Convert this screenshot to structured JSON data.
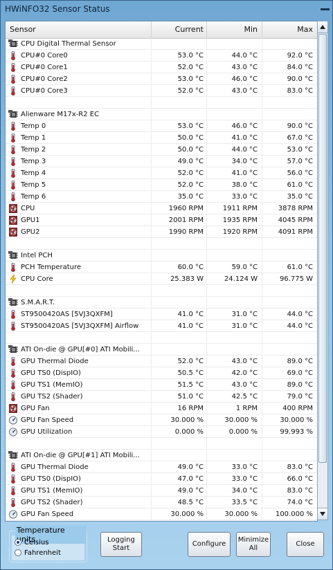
{
  "window": {
    "title": "HWiNFO32 Sensor Status"
  },
  "columns": {
    "sensor": "Sensor",
    "current": "Current",
    "min": "Min",
    "max": "Max"
  },
  "rows": [
    {
      "type": "group",
      "icon": "chip-icon",
      "name": "CPU Digital Thermal Sensor"
    },
    {
      "type": "data",
      "icon": "thermometer-icon",
      "name": "CPU#0 Core0",
      "current": "53.0 °C",
      "min": "44.0 °C",
      "max": "92.0 °C"
    },
    {
      "type": "data",
      "icon": "thermometer-icon",
      "name": "CPU#0 Core1",
      "current": "52.0 °C",
      "min": "43.0 °C",
      "max": "84.0 °C"
    },
    {
      "type": "data",
      "icon": "thermometer-icon",
      "name": "CPU#0 Core2",
      "current": "53.0 °C",
      "min": "46.0 °C",
      "max": "90.0 °C"
    },
    {
      "type": "data",
      "icon": "thermometer-icon",
      "name": "CPU#0 Core3",
      "current": "52.0 °C",
      "min": "43.0 °C",
      "max": "83.0 °C"
    },
    {
      "type": "blank"
    },
    {
      "type": "group",
      "icon": "chip-icon",
      "name": "Alienware M17x-R2 EC"
    },
    {
      "type": "data",
      "icon": "thermometer-icon",
      "name": "Temp 0",
      "current": "53.0 °C",
      "min": "46.0 °C",
      "max": "90.0 °C"
    },
    {
      "type": "data",
      "icon": "thermometer-icon",
      "name": "Temp 1",
      "current": "50.0 °C",
      "min": "41.0 °C",
      "max": "67.0 °C"
    },
    {
      "type": "data",
      "icon": "thermometer-icon",
      "name": "Temp 2",
      "current": "50.0 °C",
      "min": "44.0 °C",
      "max": "53.0 °C"
    },
    {
      "type": "data",
      "icon": "thermometer-icon",
      "name": "Temp 3",
      "current": "49.0 °C",
      "min": "34.0 °C",
      "max": "57.0 °C"
    },
    {
      "type": "data",
      "icon": "thermometer-icon",
      "name": "Temp 4",
      "current": "52.0 °C",
      "min": "41.0 °C",
      "max": "56.0 °C"
    },
    {
      "type": "data",
      "icon": "thermometer-icon",
      "name": "Temp 5",
      "current": "52.0 °C",
      "min": "38.0 °C",
      "max": "61.0 °C"
    },
    {
      "type": "data",
      "icon": "thermometer-icon",
      "name": "Temp 6",
      "current": "35.0 °C",
      "min": "33.0 °C",
      "max": "35.0 °C"
    },
    {
      "type": "data",
      "icon": "fan-icon",
      "name": "CPU",
      "current": "1960 RPM",
      "min": "1911 RPM",
      "max": "3878 RPM"
    },
    {
      "type": "data",
      "icon": "fan-icon",
      "name": "GPU1",
      "current": "2001 RPM",
      "min": "1935 RPM",
      "max": "4045 RPM"
    },
    {
      "type": "data",
      "icon": "fan-icon",
      "name": "GPU2",
      "current": "1990 RPM",
      "min": "1920 RPM",
      "max": "4091 RPM"
    },
    {
      "type": "blank"
    },
    {
      "type": "group",
      "icon": "chip-icon",
      "name": "Intel PCH"
    },
    {
      "type": "data",
      "icon": "thermometer-icon",
      "name": "PCH Temperature",
      "current": "60.0 °C",
      "min": "59.0 °C",
      "max": "61.0 °C"
    },
    {
      "type": "data",
      "icon": "lightning-icon",
      "name": "CPU Core",
      "current": "25.383 W",
      "min": "24.124 W",
      "max": "96.775 W"
    },
    {
      "type": "blank"
    },
    {
      "type": "group",
      "icon": "chip-icon",
      "name": "S.M.A.R.T."
    },
    {
      "type": "data",
      "icon": "thermometer-icon",
      "name": "ST9500420AS [5VJ3QXFM]",
      "current": "41.0 °C",
      "min": "31.0 °C",
      "max": "44.0 °C"
    },
    {
      "type": "data",
      "icon": "thermometer-icon",
      "name": "ST9500420AS [5VJ3QXFM] Airflow",
      "current": "41.0 °C",
      "min": "31.0 °C",
      "max": "44.0 °C"
    },
    {
      "type": "blank"
    },
    {
      "type": "group",
      "icon": "chip-icon",
      "name": "ATI On-die @ GPU[#0] ATI Mobili..."
    },
    {
      "type": "data",
      "icon": "thermometer-icon",
      "name": "GPU Thermal Diode",
      "current": "52.0 °C",
      "min": "43.0 °C",
      "max": "89.0 °C"
    },
    {
      "type": "data",
      "icon": "thermometer-icon",
      "name": "GPU TS0 (DispIO)",
      "current": "50.5 °C",
      "min": "42.0 °C",
      "max": "69.0 °C"
    },
    {
      "type": "data",
      "icon": "thermometer-icon",
      "name": "GPU TS1 (MemIO)",
      "current": "51.5 °C",
      "min": "43.0 °C",
      "max": "89.0 °C"
    },
    {
      "type": "data",
      "icon": "thermometer-icon",
      "name": "GPU TS2 (Shader)",
      "current": "51.0 °C",
      "min": "42.5 °C",
      "max": "79.0 °C"
    },
    {
      "type": "data",
      "icon": "fan-icon",
      "name": "GPU Fan",
      "current": "16 RPM",
      "min": "1 RPM",
      "max": "400 RPM"
    },
    {
      "type": "data",
      "icon": "gauge-icon",
      "name": "GPU Fan Speed",
      "current": "30.000 %",
      "min": "30.000 %",
      "max": "30.000 %"
    },
    {
      "type": "data",
      "icon": "gauge-icon",
      "name": "GPU Utilization",
      "current": "0.000 %",
      "min": "0.000 %",
      "max": "99.993 %"
    },
    {
      "type": "blank"
    },
    {
      "type": "group",
      "icon": "chip-icon",
      "name": "ATI On-die @ GPU[#1] ATI Mobili..."
    },
    {
      "type": "data",
      "icon": "thermometer-icon",
      "name": "GPU Thermal Diode",
      "current": "49.0 °C",
      "min": "33.0 °C",
      "max": "83.0 °C"
    },
    {
      "type": "data",
      "icon": "thermometer-icon",
      "name": "GPU TS0 (DispIO)",
      "current": "47.0 °C",
      "min": "33.0 °C",
      "max": "66.0 °C"
    },
    {
      "type": "data",
      "icon": "thermometer-icon",
      "name": "GPU TS1 (MemIO)",
      "current": "49.0 °C",
      "min": "34.0 °C",
      "max": "83.0 °C"
    },
    {
      "type": "data",
      "icon": "thermometer-icon",
      "name": "GPU TS2 (Shader)",
      "current": "48.5 °C",
      "min": "33.5 °C",
      "max": "74.0 °C"
    },
    {
      "type": "data",
      "icon": "gauge-icon",
      "name": "GPU Fan Speed",
      "current": "30.000 %",
      "min": "30.000 %",
      "max": "100.000 %"
    }
  ],
  "temperature_units": {
    "title": "Temperature units",
    "options": [
      {
        "label": "Celsius",
        "selected": true
      },
      {
        "label": "Fahrenheit",
        "selected": false
      }
    ]
  },
  "buttons": {
    "logging_start": "Logging Start",
    "configure": "Configure",
    "minimize_all": "Minimize All",
    "close": "Close"
  }
}
